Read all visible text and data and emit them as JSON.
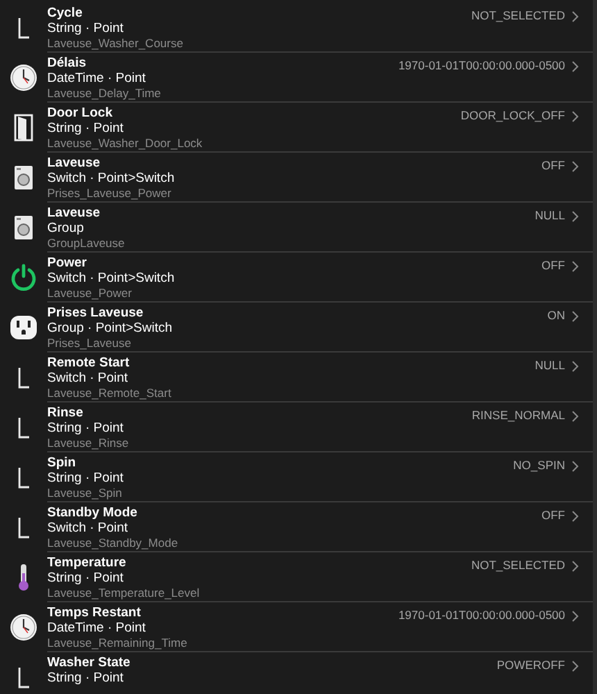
{
  "items": [
    {
      "kind": "line",
      "title": "Cycle",
      "type": "String · Point",
      "name": "Laveuse_Washer_Course",
      "value": "NOT_SELECTED"
    },
    {
      "kind": "clock",
      "title": "Délais",
      "type": "DateTime · Point",
      "name": "Laveuse_Delay_Time",
      "value": "1970-01-01T00:00:00.000-0500"
    },
    {
      "kind": "door",
      "title": "Door Lock",
      "type": "String · Point",
      "name": "Laveuse_Washer_Door_Lock",
      "value": "DOOR_LOCK_OFF"
    },
    {
      "kind": "washer",
      "title": "Laveuse",
      "type": "Switch · Point>Switch",
      "name": "Prises_Laveuse_Power",
      "value": "OFF"
    },
    {
      "kind": "washer",
      "title": "Laveuse",
      "type": "Group",
      "name": "GroupLaveuse",
      "value": "NULL"
    },
    {
      "kind": "power",
      "title": "Power",
      "type": "Switch · Point>Switch",
      "name": "Laveuse_Power",
      "value": "OFF"
    },
    {
      "kind": "outlet",
      "title": "Prises Laveuse",
      "type": "Group · Point>Switch",
      "name": "Prises_Laveuse",
      "value": "ON"
    },
    {
      "kind": "line",
      "title": "Remote Start",
      "type": "Switch · Point",
      "name": "Laveuse_Remote_Start",
      "value": "NULL"
    },
    {
      "kind": "line",
      "title": "Rinse",
      "type": "String · Point",
      "name": "Laveuse_Rinse",
      "value": "RINSE_NORMAL"
    },
    {
      "kind": "line",
      "title": "Spin",
      "type": "String · Point",
      "name": "Laveuse_Spin",
      "value": "NO_SPIN"
    },
    {
      "kind": "line",
      "title": "Standby Mode",
      "type": "Switch · Point",
      "name": "Laveuse_Standby_Mode",
      "value": "OFF"
    },
    {
      "kind": "thermometer",
      "title": "Temperature",
      "type": "String · Point",
      "name": "Laveuse_Temperature_Level",
      "value": "NOT_SELECTED"
    },
    {
      "kind": "clock",
      "title": "Temps Restant",
      "type": "DateTime · Point",
      "name": "Laveuse_Remaining_Time",
      "value": "1970-01-01T00:00:00.000-0500"
    },
    {
      "kind": "line",
      "title": "Washer State",
      "type": "String · Point",
      "value": "POWEROFF"
    }
  ]
}
